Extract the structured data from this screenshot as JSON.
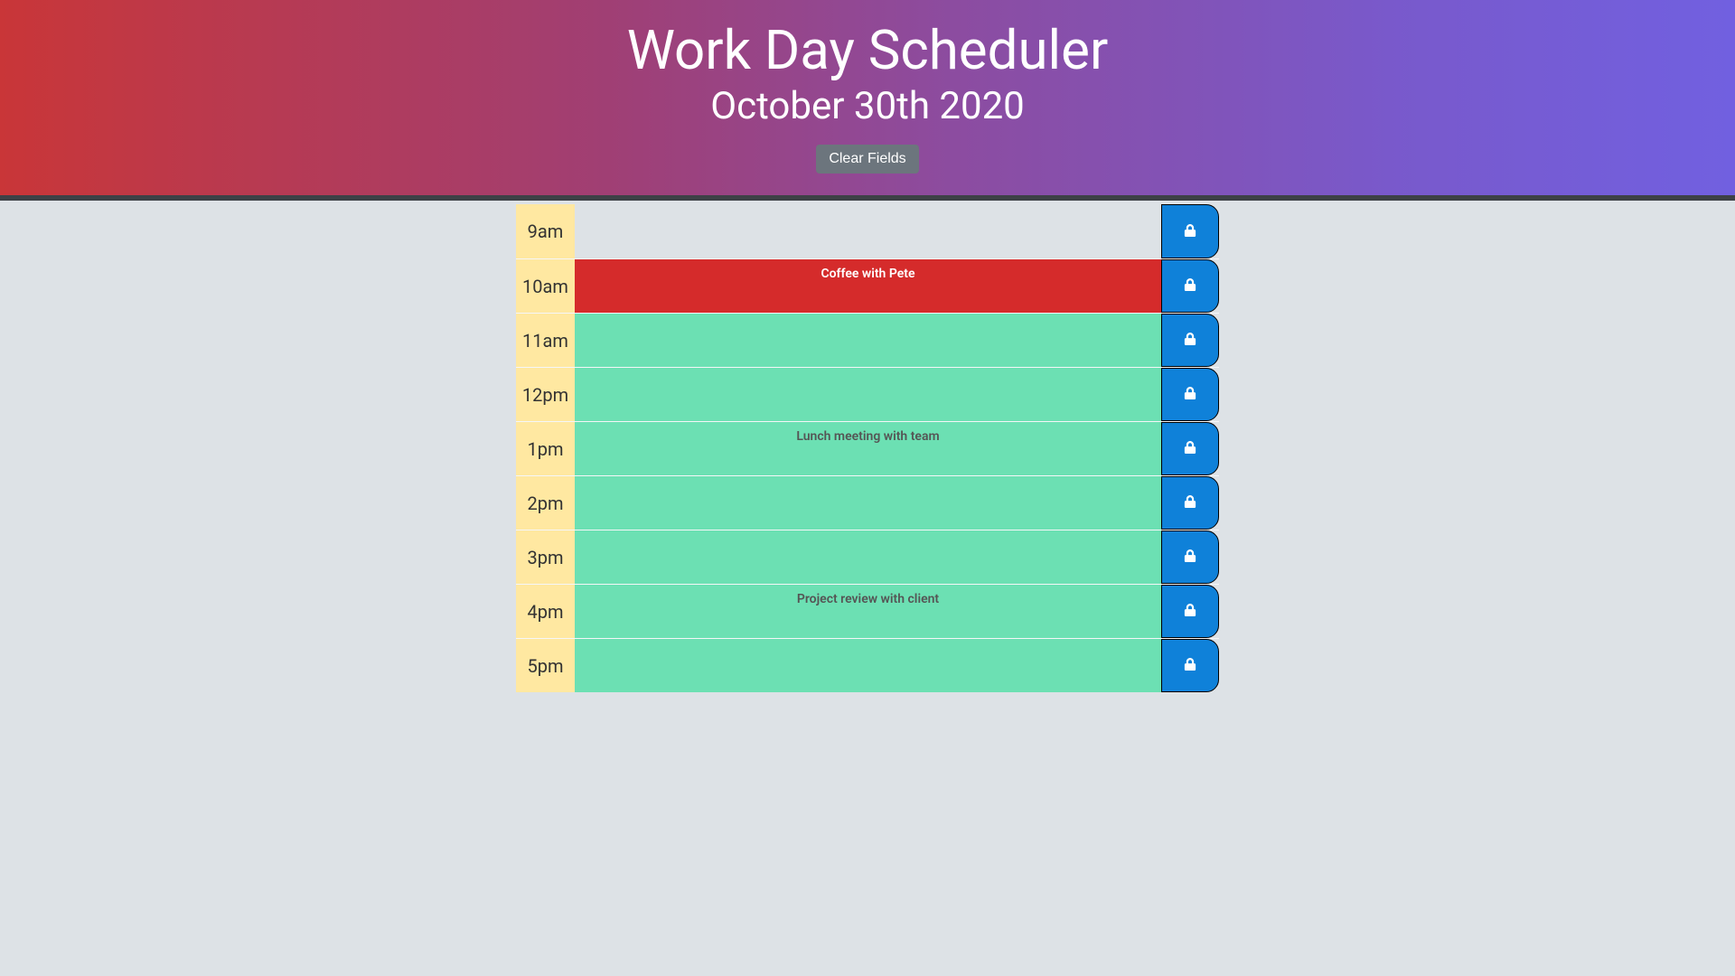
{
  "header": {
    "title": "Work Day Scheduler",
    "date": "October 30th 2020",
    "clear_label": "Clear Fields"
  },
  "rows": [
    {
      "hour": "9am",
      "state": "past",
      "event": ""
    },
    {
      "hour": "10am",
      "state": "present",
      "event": "Coffee with Pete"
    },
    {
      "hour": "11am",
      "state": "future",
      "event": ""
    },
    {
      "hour": "12pm",
      "state": "future",
      "event": ""
    },
    {
      "hour": "1pm",
      "state": "future",
      "event": "Lunch meeting with team"
    },
    {
      "hour": "2pm",
      "state": "future",
      "event": ""
    },
    {
      "hour": "3pm",
      "state": "future",
      "event": ""
    },
    {
      "hour": "4pm",
      "state": "future",
      "event": "Project review with client"
    },
    {
      "hour": "5pm",
      "state": "future",
      "event": ""
    }
  ],
  "icons": {
    "save": "lock-icon"
  }
}
